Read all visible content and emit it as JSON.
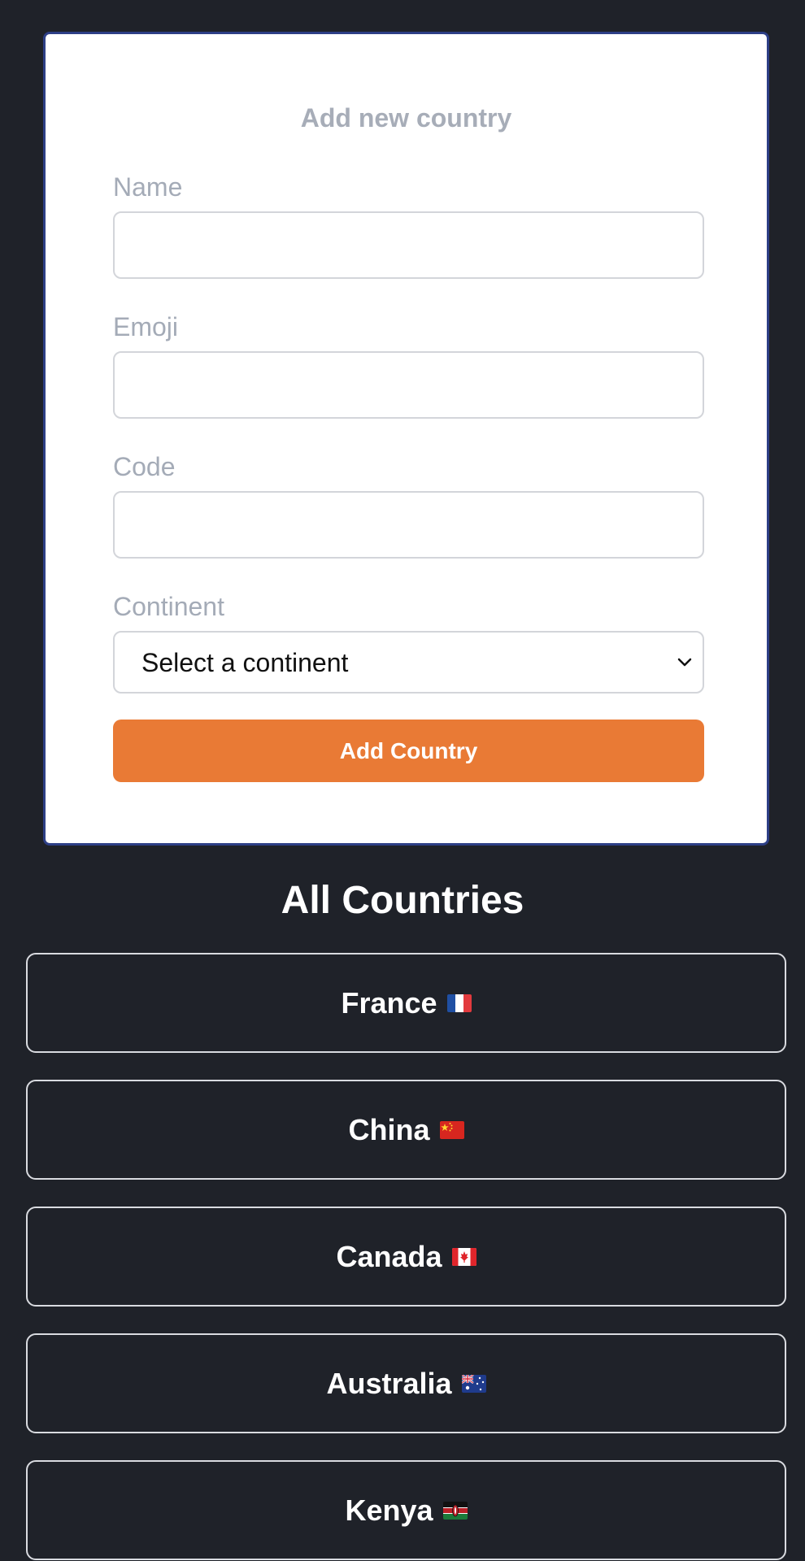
{
  "form": {
    "title": "Add new country",
    "fields": [
      {
        "label": "Name",
        "value": "",
        "placeholder": ""
      },
      {
        "label": "Emoji",
        "value": "",
        "placeholder": ""
      },
      {
        "label": "Code",
        "value": "",
        "placeholder": ""
      }
    ],
    "continent": {
      "label": "Continent",
      "selected": "Select a continent"
    },
    "submit_label": "Add Country"
  },
  "list": {
    "title": "All Countries",
    "countries": [
      {
        "name": "France",
        "flag": "france-flag-icon"
      },
      {
        "name": "China",
        "flag": "china-flag-icon"
      },
      {
        "name": "Canada",
        "flag": "canada-flag-icon"
      },
      {
        "name": "Australia",
        "flag": "australia-flag-icon"
      },
      {
        "name": "Kenya",
        "flag": "kenya-flag-icon"
      }
    ]
  },
  "colors": {
    "background": "#1f2229",
    "card": "#ffffff",
    "card_border": "#2d3f86",
    "accent": "#e97a35",
    "label": "#a4abb7"
  }
}
